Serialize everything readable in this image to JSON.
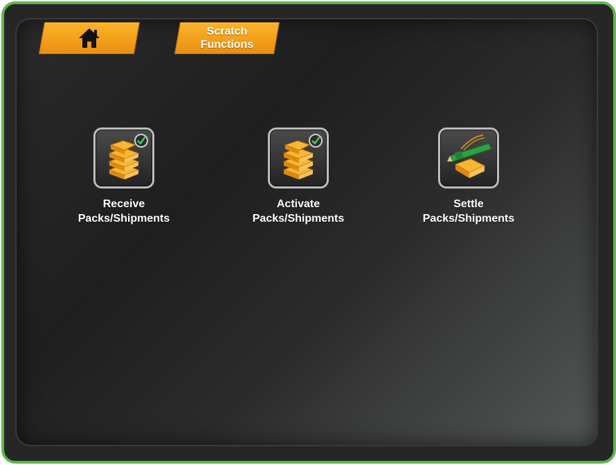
{
  "tabs": {
    "home": {
      "icon": "home-icon"
    },
    "scratch": {
      "label": "Scratch Functions"
    }
  },
  "tiles": [
    {
      "id": "receive",
      "label_line1": "Receive",
      "label_line2": "Packs/Shipments",
      "icon": "stack-check-icon"
    },
    {
      "id": "activate",
      "label_line1": "Activate",
      "label_line2": "Packs/Shipments",
      "icon": "stack-check-icon",
      "highlighted": true
    },
    {
      "id": "settle",
      "label_line1": "Settle",
      "label_line2": "Packs/Shipments",
      "icon": "pen-pack-icon"
    }
  ],
  "colors": {
    "frame_border": "#5db84a",
    "tab_orange": "#f39d1a",
    "highlight_red": "#d0142e"
  }
}
